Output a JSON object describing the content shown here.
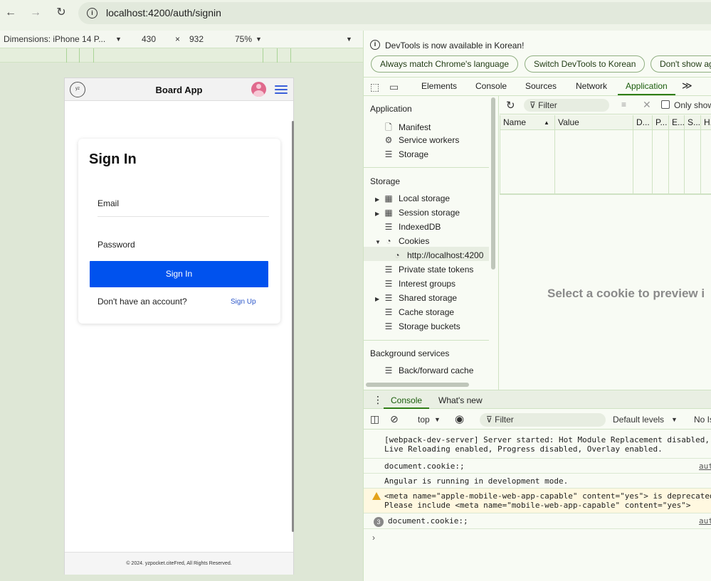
{
  "browser": {
    "url": "localhost:4200/auth/signin"
  },
  "device_toolbar": {
    "device": "Dimensions: iPhone 14 P...",
    "width": "430",
    "times": "×",
    "height": "932",
    "zoom": "75%"
  },
  "app": {
    "logo_text": "yz",
    "title": "Board App",
    "signin_title": "Sign In",
    "email_label": "Email",
    "password_label": "Password",
    "signin_button": "Sign In",
    "no_account_text": "Don't have an account?",
    "signup_link": "Sign Up",
    "footer": "© 2024. yzpocket.citeFred, All Rights Reserved."
  },
  "devtools": {
    "info_text": "DevTools is now available in Korean!",
    "pills": [
      "Always match Chrome's language",
      "Switch DevTools to Korean",
      "Don't show ag"
    ],
    "tabs": [
      "Elements",
      "Console",
      "Sources",
      "Network",
      "Application"
    ],
    "active_tab": "Application",
    "more_tabs": "≫",
    "sidebar": {
      "application_head": "Application",
      "application_items": [
        "Manifest",
        "Service workers",
        "Storage"
      ],
      "storage_head": "Storage",
      "storage_items": [
        "Local storage",
        "Session storage",
        "IndexedDB",
        "Cookies",
        "http://localhost:4200",
        "Private state tokens",
        "Interest groups",
        "Shared storage",
        "Cache storage",
        "Storage buckets"
      ],
      "background_head": "Background services",
      "background_items": [
        "Back/forward cache"
      ]
    },
    "cookie_toolbar": {
      "filter_placeholder": "Filter",
      "only_show": "Only show"
    },
    "table_headers": [
      "Name",
      "Value",
      "D...",
      "P...",
      "E...",
      "S...",
      "H."
    ],
    "preview_message": "Select a cookie to preview i",
    "drawer_tabs": [
      "Console",
      "What's new"
    ],
    "console_toolbar": {
      "context": "top",
      "filter_placeholder": "Filter",
      "levels": "Default levels",
      "issues": "No Is"
    },
    "console_messages": [
      {
        "text": "[webpack-dev-server] Server started: Hot Module Replacement disabled,\nLive Reloading enabled, Progress disabled, Overlay enabled.",
        "source": ""
      },
      {
        "text": "document.cookie:;",
        "source": "aut"
      },
      {
        "text": "Angular is running in development mode.",
        "source": ""
      },
      {
        "text": "<meta name=\"apple-mobile-web-app-capable\" content=\"yes\"> is deprecated\nPlease include <meta name=\"mobile-web-app-capable\" content=\"yes\">",
        "source": ""
      },
      {
        "text": "document.cookie:;",
        "source": "aut",
        "count": "3"
      }
    ],
    "prompt": "›"
  },
  "colors": {
    "accent": "#0052ee",
    "devtools_green": "#2f7d16",
    "warning": "#e3a21a"
  }
}
